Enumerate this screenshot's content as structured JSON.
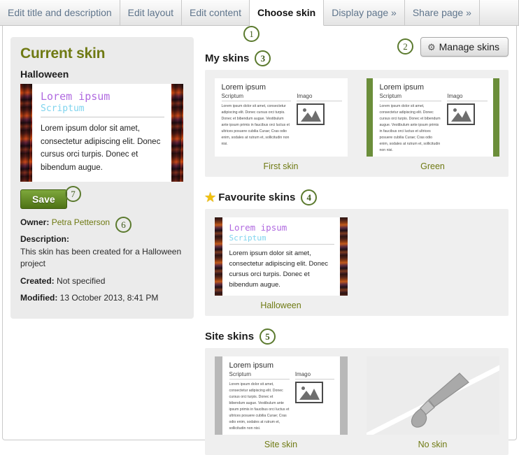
{
  "tabs": [
    {
      "label": "Edit title and description",
      "active": false
    },
    {
      "label": "Edit layout",
      "active": false
    },
    {
      "label": "Edit content",
      "active": false
    },
    {
      "label": "Choose skin",
      "active": true
    },
    {
      "label": "Display page »",
      "active": false
    },
    {
      "label": "Share page »",
      "active": false
    }
  ],
  "markers": {
    "m1": "1",
    "m2": "2",
    "m3": "3",
    "m4": "4",
    "m5": "5",
    "m6": "6",
    "m7": "7"
  },
  "left_panel": {
    "title": "Current skin",
    "skin_name": "Halloween",
    "preview": {
      "heading": "Lorem ipsum",
      "subheading": "Scriptum",
      "body": "Lorem ipsum dolor sit amet, consectetur adipiscing elit. Donec cursus orci turpis. Donec et bibendum augue."
    },
    "save_label": "Save",
    "meta": {
      "owner_label": "Owner:",
      "owner_value": "Petra Petterson",
      "description_label": "Description:",
      "description_value": "This skin has been created for a Halloween project",
      "created_label": "Created:",
      "created_value": "Not specified",
      "modified_label": "Modified:",
      "modified_value": "13 October 2013, 8:41 PM"
    }
  },
  "manage_button": {
    "label": "Manage skins",
    "icon": "gear-icon"
  },
  "thumb_text": {
    "heading": "Lorem ipsum",
    "subheading": "Scriptum",
    "image_label": "Imago",
    "body": "Lorem ipsum dolor sit amet, consectetur adipiscing elit. Donec cursus orci turpis. Donec et bibendum augue. Vestibulum ante ipsum primis in faucibus orci luctus et ultrices posuere cubilia Curae; Cras odio enim, sodales at rutrum et, sollicitudin non nisi."
  },
  "sections": {
    "my_skins": {
      "title": "My skins",
      "items": [
        {
          "label": "First skin",
          "style": "plain"
        },
        {
          "label": "Green",
          "style": "green"
        }
      ]
    },
    "favourite_skins": {
      "title": "Favourite skins",
      "icon": "star-icon",
      "items": [
        {
          "label": "Halloween",
          "style": "halloween"
        }
      ]
    },
    "site_skins": {
      "title": "Site skins",
      "items": [
        {
          "label": "Site skin",
          "style": "gray"
        },
        {
          "label": "No skin",
          "style": "none"
        }
      ]
    }
  },
  "colors": {
    "accent_green": "#6f7a13",
    "marker_green": "#5b7a2e",
    "save_green": "#4e7215",
    "star_gold": "#f2c10e",
    "panel_gray": "#efefef"
  }
}
